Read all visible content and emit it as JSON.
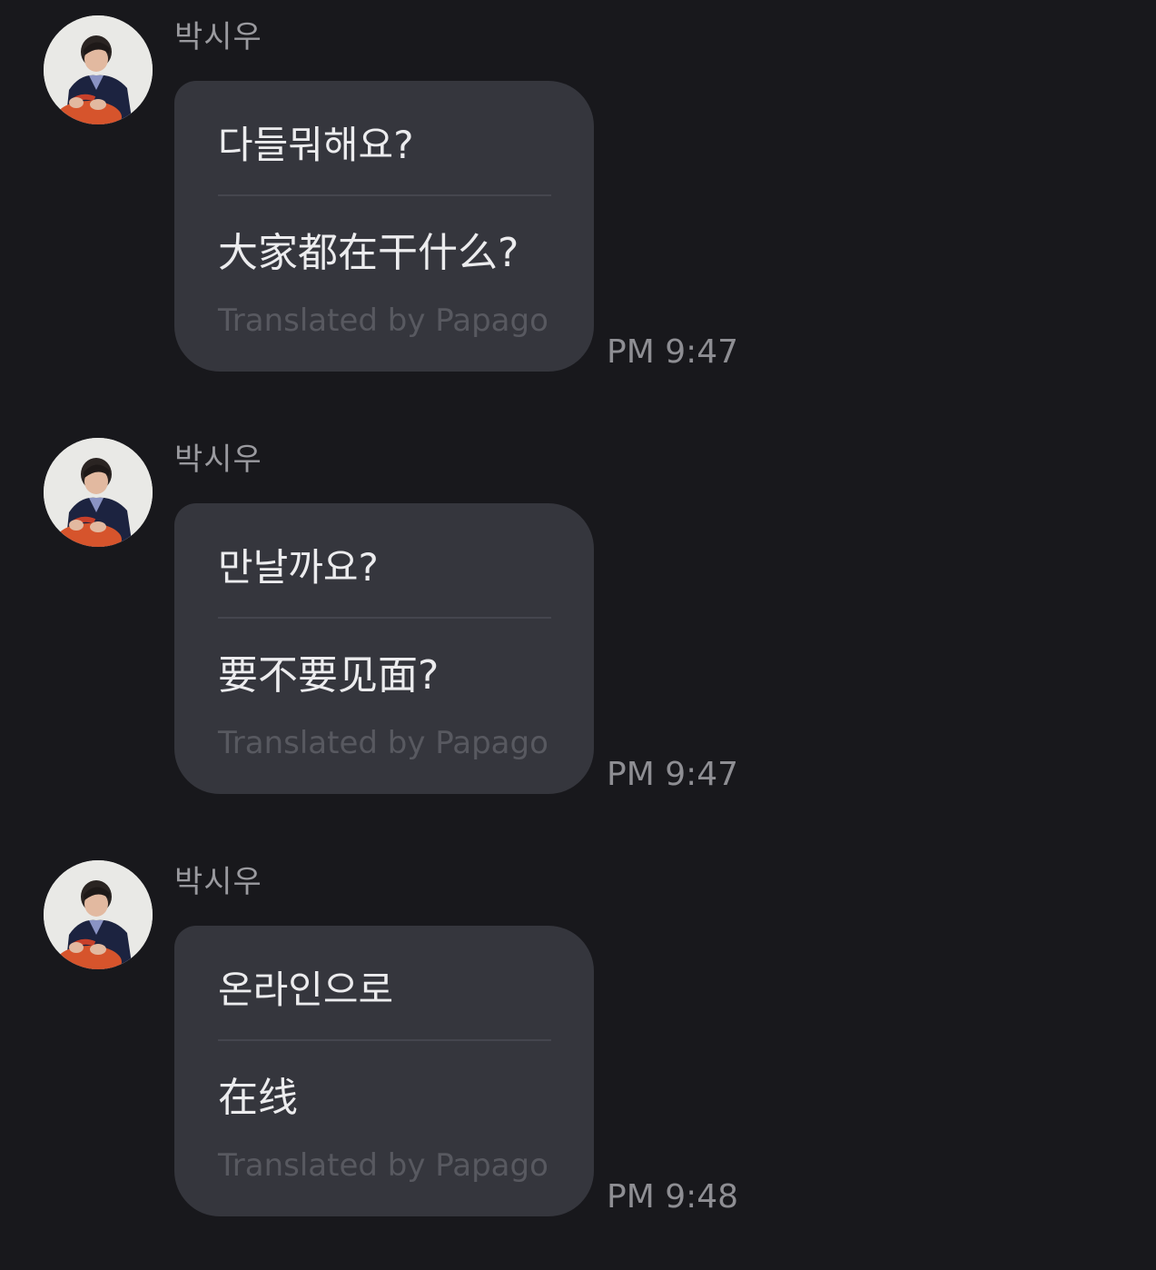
{
  "messages": [
    {
      "sender": "박시우",
      "original": "다들뭐해요?",
      "translated": "大家都在干什么?",
      "credit": "Translated by Papago",
      "time": "PM 9:47"
    },
    {
      "sender": "박시우",
      "original": "만날까요?",
      "translated": "要不要见面?",
      "credit": "Translated by Papago",
      "time": "PM 9:47"
    },
    {
      "sender": "박시우",
      "original": "온라인으로",
      "translated": "在线",
      "credit": "Translated by Papago",
      "time": "PM 9:48"
    }
  ],
  "colors": {
    "background": "#18181c",
    "bubble": "#35363d",
    "text": "#ececee",
    "sender": "#9a9a9f",
    "credit": "#585960",
    "time": "#8e8e93"
  }
}
